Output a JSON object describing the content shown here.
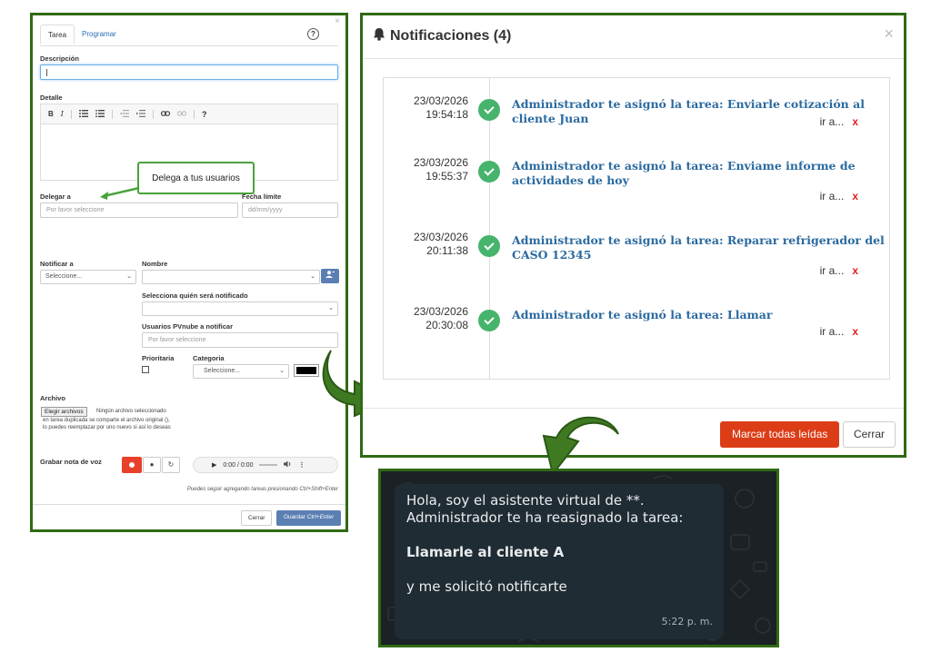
{
  "task_form": {
    "close_glyph": "×",
    "tabs": [
      {
        "label": "Tarea",
        "active": true
      },
      {
        "label": "Programar",
        "active": false
      }
    ],
    "help_glyph": "?",
    "descripcion_label": "Descripción",
    "detalle_label": "Detalle",
    "editor_tools": [
      "B",
      "I",
      "?"
    ],
    "callout": "Delega a tus usuarios",
    "delegar_label": "Delegar a",
    "delegar_placeholder": "Por favor seleccione",
    "fecha_label": "Fecha límite",
    "fecha_placeholder": "dd/mm/yyyy",
    "notificar_label": "Notificar a",
    "notificar_value": "Seleccione...",
    "nombre_label": "Nombre",
    "notificado_label": "Selecciona quién será notificado",
    "usuarios_label": "Usuarios PVnube a notificar",
    "usuarios_placeholder": "Por favor seleccione",
    "prioritaria_label": "Prioritaria",
    "categoria_label": "Categoria",
    "categoria_value": "Seleccione...",
    "archivo_label": "Archivo",
    "file_button": "Elegir archivos",
    "file_status": "Ningún archivo seleccionado",
    "file_note_1": "en tarea duplicada se comparte el archivo original (),",
    "file_note_2": "lo puedes reemplazar por uno nuevo si así lo deseas",
    "voz_label": "Grabar nota de voz",
    "audio_time": "0:00 / 0:00",
    "hint": "Puedes seguir agregando tareas presionando Ctrl+Shift+Enter",
    "cerrar_button": "Cerrar",
    "guardar_button": "Guardar",
    "guardar_shortcut": "Ctrl+Enter"
  },
  "notifications": {
    "title": "Notificaciones (4)",
    "close_glyph": "×",
    "items": [
      {
        "date": "23/03/2026",
        "time": "19:54:18",
        "message": "Administrador te asignó la tarea: Enviarle cotización al cliente Juan",
        "link": "ir a...",
        "delete": "x"
      },
      {
        "date": "23/03/2026",
        "time": "19:55:37",
        "message": "Administrador te asignó la tarea: Enviame informe de actividades de hoy",
        "link": "ir a...",
        "delete": "x"
      },
      {
        "date": "23/03/2026",
        "time": "20:11:38",
        "message": "Administrador te asignó la tarea: Reparar refrigerador del CASO 12345",
        "link": "ir a...",
        "delete": "x"
      },
      {
        "date": "23/03/2026",
        "time": "20:30:08",
        "message": "Administrador te asignó la tarea: Llamar",
        "link": "ir a...",
        "delete": "x"
      }
    ],
    "mark_all_button": "Marcar todas leídas",
    "close_button": "Cerrar"
  },
  "chat": {
    "line1": "Hola, soy el asistente virtual de **.",
    "line2": "Administrador te ha reasignado la tarea:",
    "task": "Llamarle al cliente A",
    "line3": "y me solicitó notificarte",
    "time": "5:22 p. m."
  },
  "colors": {
    "frame": "#2f6a14",
    "accent_blue": "#5b7fb2",
    "record_red": "#e8402b",
    "mark_button": "#dc3d17",
    "check_green": "#46b46c",
    "chat_bg": "#1c2125",
    "bubble_bg": "#202c33"
  }
}
